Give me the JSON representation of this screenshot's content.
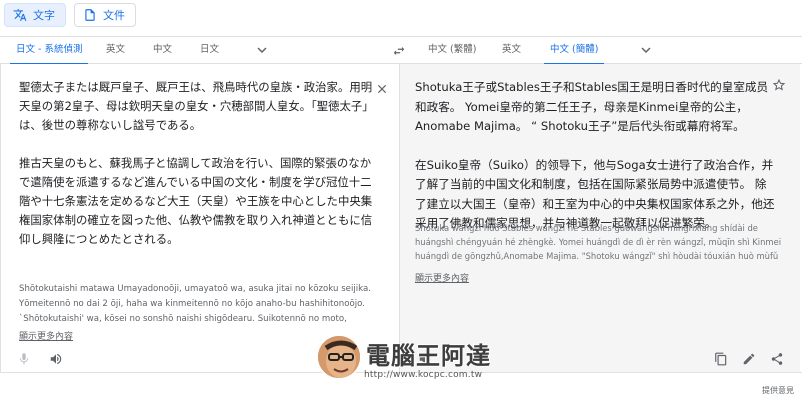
{
  "modes": {
    "text": "文字",
    "document": "文件"
  },
  "source_langs": {
    "detected": "日文 - 系統偵測",
    "lang1": "英文",
    "lang2": "中文",
    "lang3": "日文"
  },
  "target_langs": {
    "lang1": "中文 (繁體)",
    "lang2": "英文",
    "lang3": "中文 (簡體)"
  },
  "source": {
    "para1": "聖德太子または厩戸皇子、厩戸王は、飛鳥時代の皇族・政治家。用明天皇の第2皇子、母は欽明天皇の皇女・穴穂部間人皇女。「聖徳太子」は、後世の尊称ないし諡号である。",
    "para2": "推古天皇のもと、蘇我馬子と協調して政治を行い、国際的緊張のなかで遣隋使を派遣するなど進んでいる中国の文化・制度を学び冠位十二階や十七条憲法を定めるなど大王（天皇）や王族を中心とした中央集権国家体制の確立を図った他、仏教や儒教を取り入れ神道とともに信仰し興隆につとめたとされる。",
    "romaji": "Shōtokutaishi matawa Umayadonoōji, umayatoō wa, asuka jitai no kōzoku seijika. Yōmeitennō no dai 2 ōji, haha wa kinmeitennō no kōjo anaho-bu hashihitonoōjo. `Shōtokutaishi' wa, kōsei no sonshō naishi shigōdearu. Suikotennō no moto,",
    "show_more": "顯示更多內容"
  },
  "target": {
    "para1": "Shotuka王子或Stables王子和Stables国王是明日香时代的皇室成员和政客。 Yomei皇帝的第二任王子，母亲是Kinmei皇帝的公主，Anomabe Majima。 “ Shotoku王子”是后代头衔或幕府将军。",
    "para2": "在Suiko皇帝（Suiko）的领导下，他与Soga女士进行了政治合作，并了解了当前的中国文化和制度，包括在国际紧张局势中派遣使节。 除了建立以大国王（皇帝）和王室为中心的中央集权国家体系之外，他还采用了佛教和儒家思想，并与神道教一起敬拜以促进繁荣。",
    "pinyin": "Shotuka wángzǐ huò Stables wángzǐ hé Stables guówángshì míngrìxiāng shídài de huángshì chéngyuán hé zhèngkè. Yomei huángdì de dì èr rèn wángzǐ, mǔqīn shì Kinmei huángdì de gōngzhǔ,Anomabe Majima. \"Shotoku wángzǐ\" shì hòudài tóuxián huò mùfǔ",
    "show_more": "顯示更多內容"
  },
  "watermark": {
    "title": "電腦王阿達",
    "url": "http://www.kocpc.com.tw"
  },
  "feedback": "提供意見",
  "colors": {
    "accent": "#1a73e8",
    "target_bg": "#f5f5f5"
  }
}
